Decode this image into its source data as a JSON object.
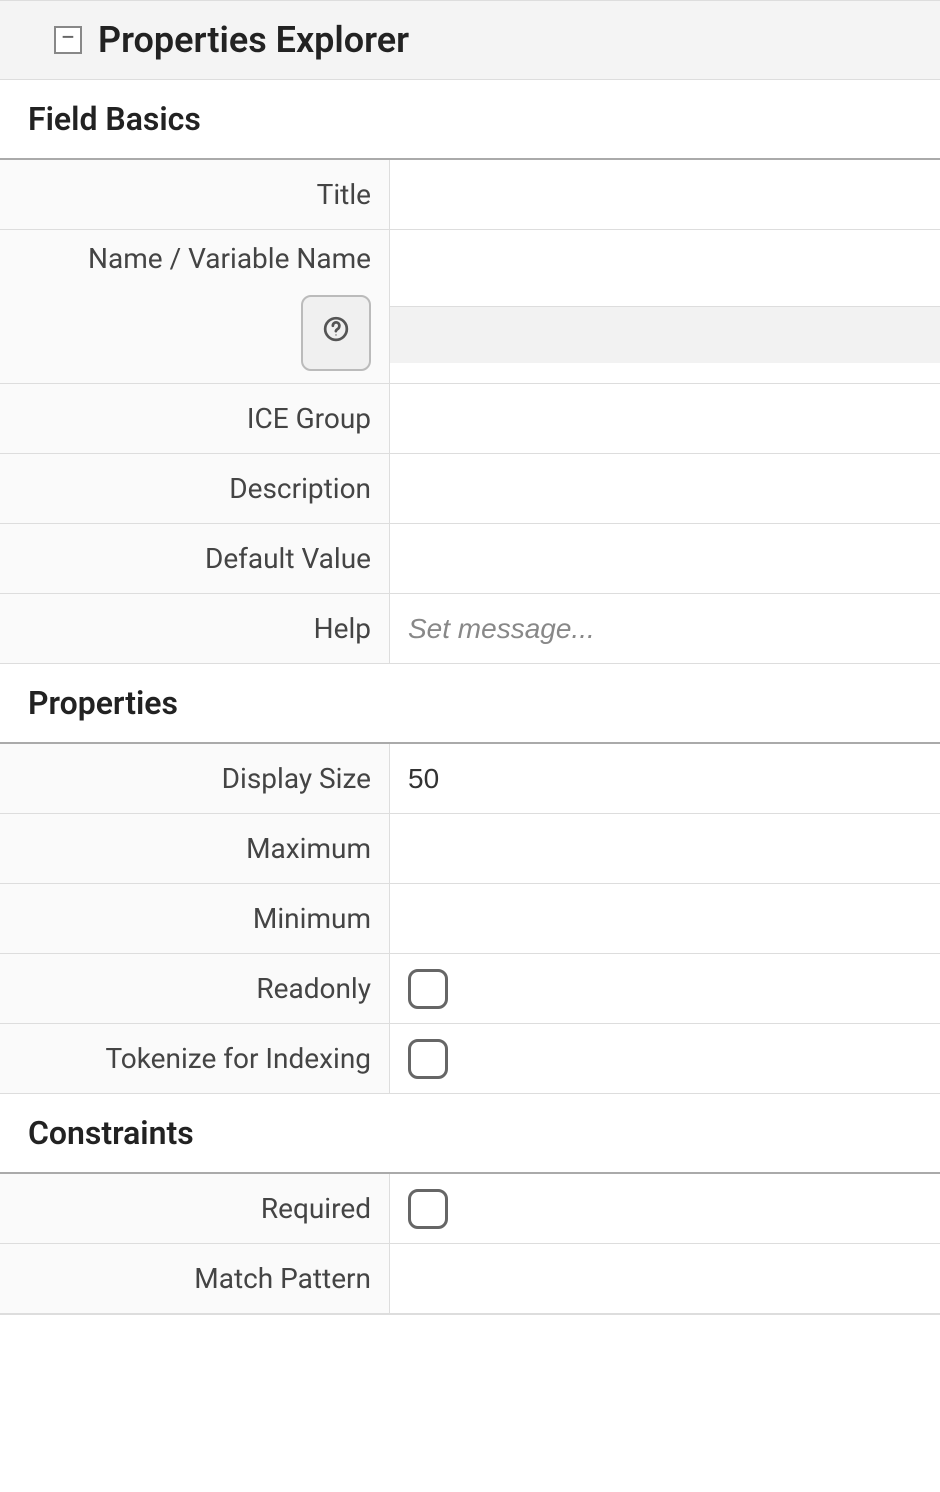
{
  "header": {
    "title": "Properties Explorer",
    "collapse_glyph": "−"
  },
  "sections": {
    "basics": {
      "title": "Field Basics",
      "fields": {
        "title_label": "Title",
        "title_value": "",
        "name_label": "Name / Variable Name",
        "name_value": "",
        "variable_value": "",
        "help_icon": "?",
        "ice_group_label": "ICE Group",
        "ice_group_value": "",
        "description_label": "Description",
        "description_value": "",
        "default_value_label": "Default Value",
        "default_value_value": "",
        "help_label": "Help",
        "help_placeholder": "Set message..."
      }
    },
    "properties": {
      "title": "Properties",
      "fields": {
        "display_size_label": "Display Size",
        "display_size_value": "50",
        "maximum_label": "Maximum",
        "maximum_value": "",
        "minimum_label": "Minimum",
        "minimum_value": "",
        "readonly_label": "Readonly",
        "readonly_checked": false,
        "tokenize_label": "Tokenize for Indexing",
        "tokenize_checked": false
      }
    },
    "constraints": {
      "title": "Constraints",
      "fields": {
        "required_label": "Required",
        "required_checked": false,
        "match_pattern_label": "Match Pattern",
        "match_pattern_value": ""
      }
    }
  }
}
